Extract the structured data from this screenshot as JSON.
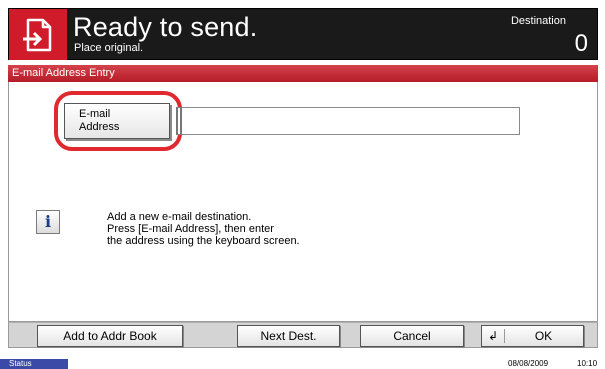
{
  "header": {
    "title": "Ready to send.",
    "subtitle": "Place original.",
    "destination_label": "Destination",
    "destination_count": "0",
    "icon": "send-document-icon",
    "accent_color": "#d01c2a"
  },
  "titlebar": {
    "label": "E-mail Address Entry",
    "color": "#c62832"
  },
  "main": {
    "email_button_label_line1": "E-mail",
    "email_button_label_line2": "Address",
    "email_input_value": "",
    "highlight_color": "#e0282f",
    "info_icon": "info-icon",
    "info_line1": "Add a new e-mail destination.",
    "info_line2": "Press [E-mail Address], then enter",
    "info_line3": "the address using the keyboard screen."
  },
  "buttons": {
    "add_to_addr_book": "Add to Addr Book",
    "next_dest": "Next Dest.",
    "cancel": "Cancel",
    "ok": "OK",
    "ok_icon": "return-arrow-icon"
  },
  "status": {
    "tab_label": "Status",
    "date": "08/08/2009",
    "time": "10:10",
    "tab_color": "#3b4aa6"
  }
}
